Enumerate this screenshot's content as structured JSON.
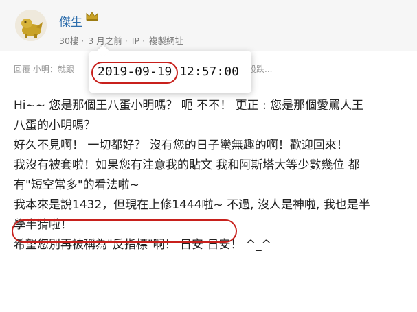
{
  "post": {
    "username": "傑生",
    "floor": "30樓",
    "time_ago": "3 月之前",
    "ip_label": "IP",
    "copy_link": "複製網址",
    "reply_prefix": "回覆 小明：就跟",
    "reply_tail": "股跌..."
  },
  "tooltip": {
    "datetime": "2019-09-19 12:57:00"
  },
  "content": {
    "lines": [
      "Hi~~ 您是那個王八蛋小明嗎？ 呃 不不！ 更正 : 您是那個愛罵人王",
      "八蛋的小明嗎？",
      "好久不見啊！ 一切都好？ 沒有您的日子蠻無趣的啊！歡迎回來！",
      "我沒有被套啦！如果您有注意我的貼文 我和阿斯塔大等少數幾位 都",
      "有\"短空常多\"的看法啦~",
      "我本來是說1432，但現在上修1444啦~ 不過, 沒人是神啦, 我也是半",
      "學半猜啦！",
      "希望您別再被稱為\"反指標\"啊！ 日安 日安！    ^_^"
    ]
  },
  "colors": {
    "username": "#2f6fad",
    "highlight_circle": "#c8201c",
    "crown": "#c9a227"
  },
  "icons": {
    "crown": "crown-icon",
    "avatar": "avatar-image"
  }
}
